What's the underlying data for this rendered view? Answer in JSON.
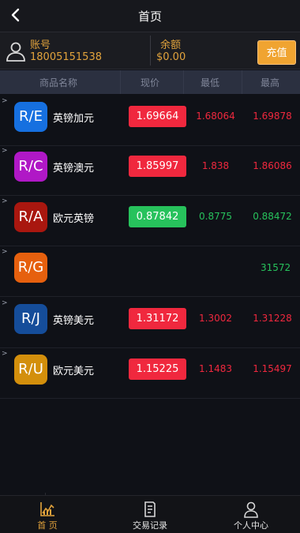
{
  "header": {
    "title": "首页",
    "back_icon": "chevron-left-icon"
  },
  "account": {
    "account_label": "账号",
    "account_value": "18005151538",
    "balance_label": "余额",
    "balance_value": "$0.00",
    "recharge_label": "充值"
  },
  "table": {
    "columns": [
      "商品名称",
      "现价",
      "最低",
      "最高"
    ],
    "rows": [
      {
        "code": "R/E",
        "name": "英镑加元",
        "price": "1.69664",
        "low": "1.68064",
        "high": "1.69878",
        "color": "#1670e0",
        "trend": "down"
      },
      {
        "code": "R/C",
        "name": "英镑澳元",
        "price": "1.85997",
        "low": "1.838",
        "high": "1.86086",
        "color": "#b018c6",
        "trend": "down"
      },
      {
        "code": "R/A",
        "name": "欧元英镑",
        "price": "0.87842",
        "low": "0.8775",
        "high": "0.88472",
        "color": "#a9170f",
        "trend": "up"
      },
      {
        "code": "R/G",
        "name": "",
        "price": "",
        "low": "",
        "high": "31572",
        "color": "#e6600e",
        "trend": "up"
      },
      {
        "code": "R/J",
        "name": "英镑美元",
        "price": "1.31172",
        "low": "1.3002",
        "high": "1.31228",
        "color": "#154d9a",
        "trend": "down"
      },
      {
        "code": "R/U",
        "name": "欧元美元",
        "price": "1.15225",
        "low": "1.1483",
        "high": "1.15497",
        "color": "#d38f0c",
        "trend": "down"
      }
    ]
  },
  "colors": {
    "down": "#f0283e",
    "up": "#27c25c",
    "accent": "#e2a33c"
  },
  "tabbar": {
    "items": [
      {
        "label": "首 页",
        "icon": "chart-icon",
        "active": true
      },
      {
        "label": "交易记录",
        "icon": "document-icon",
        "active": false
      },
      {
        "label": "个人中心",
        "icon": "user-icon",
        "active": false
      }
    ]
  }
}
